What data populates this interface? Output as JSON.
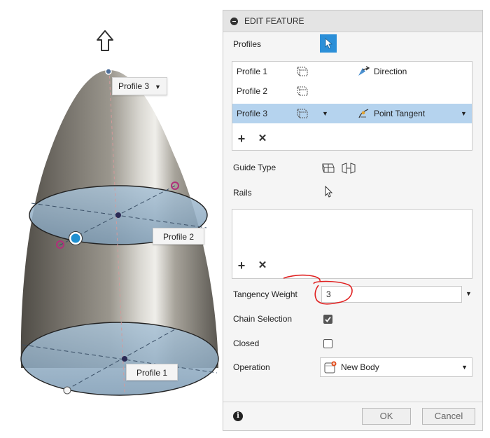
{
  "panel": {
    "title": "EDIT FEATURE",
    "profiles_label": "Profiles",
    "profiles": [
      {
        "name": "Profile 1",
        "condition": "Direction",
        "selected": false
      },
      {
        "name": "Profile 2",
        "condition": "",
        "selected": false
      },
      {
        "name": "Profile 3",
        "condition": "Point Tangent",
        "selected": true
      }
    ],
    "guide_type_label": "Guide Type",
    "rails_label": "Rails",
    "tangency_weight_label": "Tangency Weight",
    "tangency_weight_value": "3",
    "chain_selection_label": "Chain Selection",
    "chain_selection_checked": true,
    "closed_label": "Closed",
    "closed_checked": false,
    "operation_label": "Operation",
    "operation_value": "New Body",
    "ok_label": "OK",
    "cancel_label": "Cancel",
    "accent_color": "#2b8fd8",
    "selected_row_color": "#b5d3ee"
  },
  "viewport": {
    "tag_profile1": "Profile 1",
    "tag_profile2": "Profile 2",
    "tag_profile3": "Profile 3"
  }
}
